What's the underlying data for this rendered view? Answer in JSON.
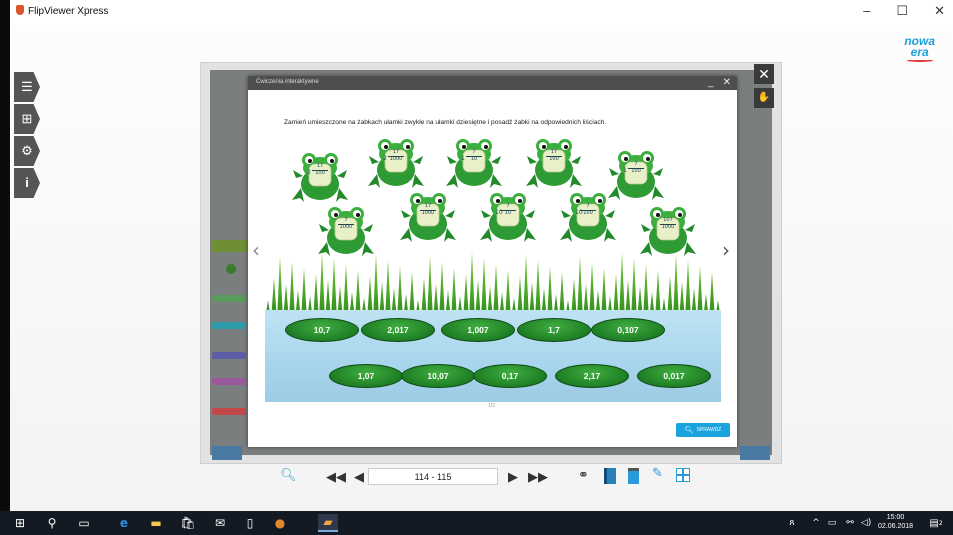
{
  "window": {
    "title": "FlipViewer Xpress",
    "minimize": "–",
    "maximize": "☐",
    "close": "✕"
  },
  "brand": {
    "line1": "nowa",
    "line2": "era"
  },
  "dialog": {
    "title": "Ćwiczenia interaktywne",
    "minimize": "_",
    "close": "✕",
    "instruction": "Zamień umieszczone na żabkach ułamki zwykłe na ułamki dziesiętne i posadź żabki na odpowiednich liściach.",
    "page_indicator": "1/2",
    "check_label": "SPRAWDŹ",
    "prev_arrow": "‹",
    "next_arrow": "›"
  },
  "frogs": [
    {
      "whole": "2",
      "num": "17",
      "den": "100"
    },
    {
      "whole": "2",
      "num": "17",
      "den": "1000"
    },
    {
      "whole": "1",
      "num": "7",
      "den": "10"
    },
    {
      "whole": "",
      "num": "17",
      "den": "100"
    },
    {
      "whole": "1",
      "num": "7",
      "den": "100"
    },
    {
      "whole": "",
      "num": "7",
      "den": "1000"
    },
    {
      "whole": "",
      "num": "17",
      "den": "1000"
    },
    {
      "whole": "10",
      "num": "7",
      "den": "10"
    },
    {
      "whole": "10",
      "num": "7",
      "den": "100"
    },
    {
      "whole": "",
      "num": "107",
      "den": "1000"
    }
  ],
  "pads_row1": [
    "10,7",
    "2,017",
    "1,007",
    "1,7",
    "0,107"
  ],
  "pads_row2": [
    "1,07",
    "10,07",
    "0,17",
    "2,17",
    "0,017"
  ],
  "toolbar": {
    "page_range": "114 - 115"
  },
  "taskbar": {
    "time": "15:00",
    "date": "02.06.2018",
    "notif_count": "2"
  },
  "colors": {
    "frog_green": "#2e9a34",
    "pad_green": "#1e7e25",
    "accent_blue": "#1aa3dc",
    "taskbar": "#141a24"
  },
  "icons": {
    "side": [
      "list-icon",
      "search-pages-icon",
      "gear-icon",
      "info-icon"
    ],
    "toolbar": [
      "zoom-icon",
      "first-page-icon",
      "prev-page-icon",
      "next-page-icon",
      "last-page-icon",
      "binoculars-icon",
      "bookmark-icon",
      "notes-icon",
      "pen-icon",
      "thumbnails-icon"
    ]
  }
}
